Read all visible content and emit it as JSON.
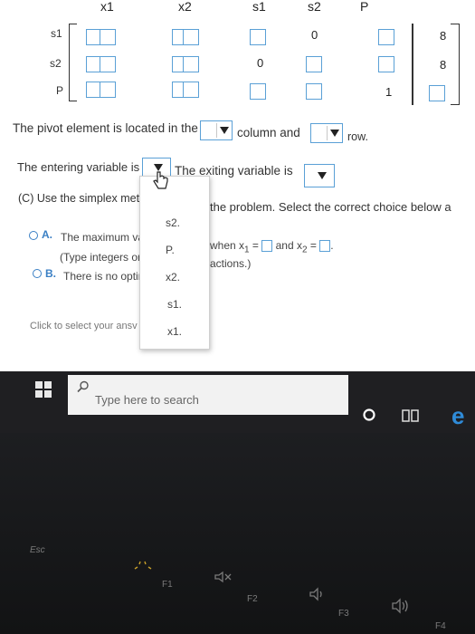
{
  "tableau": {
    "col_headers": [
      "x1",
      "x2",
      "s1",
      "s2",
      "P"
    ],
    "row_headers": [
      "s1",
      "s2",
      "P"
    ],
    "values": {
      "r0_s2": "0",
      "r0_rhs": "8",
      "r1_s1": "0",
      "r1_rhs": "8",
      "r2_P": "1"
    }
  },
  "pivot": {
    "text_start": "The pivot element is located in the",
    "text_mid": "column and",
    "text_end": "row."
  },
  "entering": {
    "text": "The entering variable is",
    "exiting_text": "The exiting variable is"
  },
  "dropdown_options": [
    "s2.",
    "P.",
    "x2.",
    "s1.",
    "x1."
  ],
  "part_c": {
    "text_start": "(C) Use the simplex met",
    "text_end": "the problem. Select the correct choice below a"
  },
  "choice_a": {
    "letter": "A.",
    "text_start": "The maximum va",
    "when_text": "when x",
    "x1_sub": "1",
    "eq": " =",
    "and_text": "and x",
    "x2_sub": "2",
    "eq2": " =",
    "hint_start": "(Type integers or",
    "hint_end": "actions.)"
  },
  "choice_b": {
    "letter": "B.",
    "text": "There is no optim"
  },
  "click_hint": "Click to select your ansv",
  "taskbar": {
    "search_placeholder": "Type here to search"
  },
  "keys": {
    "esc": "Esc",
    "f1": "F1",
    "f2": "F2",
    "f3": "F3",
    "f4": "F4"
  }
}
